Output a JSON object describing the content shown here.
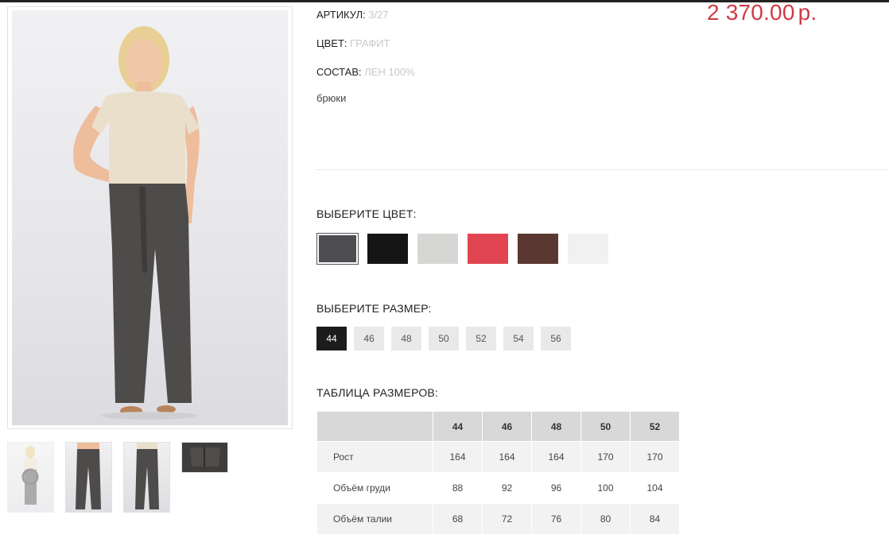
{
  "product": {
    "article_label": "АРТИКУЛ:",
    "article_value": "3/27",
    "color_label": "ЦВЕТ:",
    "color_value": "ГРАФИТ",
    "composition_label": "СОСТАВ:",
    "composition_value": "ЛЕН 100%",
    "description": "брюки",
    "price_value": "2 370.00",
    "price_currency": "р."
  },
  "colors": {
    "title": "ВЫБЕРИТЕ ЦВЕТ:",
    "swatches": [
      {
        "name": "graphite",
        "hex": "#4d4d52",
        "selected": true
      },
      {
        "name": "black",
        "hex": "#151515",
        "selected": false
      },
      {
        "name": "light-gray",
        "hex": "#d6d6d4",
        "selected": false
      },
      {
        "name": "coral-red",
        "hex": "#e24552",
        "selected": false
      },
      {
        "name": "brown",
        "hex": "#5a3730",
        "selected": false
      },
      {
        "name": "white",
        "hex": "#f1f1f1",
        "selected": false
      }
    ]
  },
  "sizes": {
    "title": "ВЫБЕРИТЕ РАЗМЕР:",
    "options": [
      "44",
      "46",
      "48",
      "50",
      "52",
      "54",
      "56"
    ],
    "selected": "44"
  },
  "size_table": {
    "title": "ТАБЛИЦА РАЗМЕРОВ:",
    "columns": [
      "44",
      "46",
      "48",
      "50",
      "52"
    ],
    "rows": [
      {
        "label": "Рост",
        "values": [
          "164",
          "164",
          "164",
          "170",
          "170"
        ]
      },
      {
        "label": "Объём груди",
        "values": [
          "88",
          "92",
          "96",
          "100",
          "104"
        ]
      },
      {
        "label": "Объём талии",
        "values": [
          "68",
          "72",
          "76",
          "80",
          "84"
        ]
      }
    ]
  },
  "gallery": {
    "thumbnail_count": 4,
    "active_thumbnail": 1
  },
  "theme": {
    "accent": "#d03a45",
    "selected_size_bg": "#1c1c1c"
  }
}
